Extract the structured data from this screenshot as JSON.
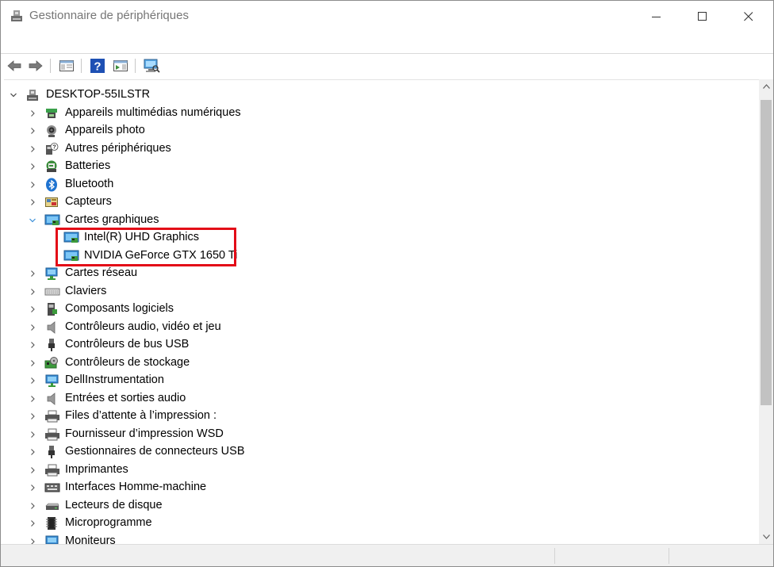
{
  "window": {
    "title": "Gestionnaire de périphériques",
    "icon": "device-manager-icon"
  },
  "toolbar": {
    "buttons": [
      {
        "name": "back-icon"
      },
      {
        "name": "forward-icon"
      },
      {
        "name": "show-hide-console-tree-icon"
      },
      {
        "name": "help-icon"
      },
      {
        "name": "properties-pane-icon"
      },
      {
        "name": "scan-hardware-icon"
      }
    ]
  },
  "tree": {
    "root": {
      "label": "DESKTOP-55ILSTR",
      "expanded": true,
      "icon": "computer-icon"
    },
    "categories": [
      {
        "label": "Appareils multimédias numériques",
        "icon": "multimedia-device-icon",
        "expanded": false
      },
      {
        "label": "Appareils photo",
        "icon": "camera-icon",
        "expanded": false
      },
      {
        "label": "Autres périphériques",
        "icon": "unknown-device-icon",
        "expanded": false
      },
      {
        "label": "Batteries",
        "icon": "battery-icon",
        "expanded": false
      },
      {
        "label": "Bluetooth",
        "icon": "bluetooth-icon",
        "expanded": false
      },
      {
        "label": "Capteurs",
        "icon": "sensor-icon",
        "expanded": false
      },
      {
        "label": "Cartes graphiques",
        "icon": "display-adapter-icon",
        "expanded": true,
        "children": [
          {
            "label": "Intel(R) UHD Graphics",
            "icon": "display-adapter-icon"
          },
          {
            "label": "NVIDIA GeForce GTX 1650 Ti",
            "icon": "display-adapter-icon"
          }
        ]
      },
      {
        "label": "Cartes réseau",
        "icon": "network-adapter-icon",
        "expanded": false
      },
      {
        "label": "Claviers",
        "icon": "keyboard-icon",
        "expanded": false
      },
      {
        "label": "Composants logiciels",
        "icon": "software-component-icon",
        "expanded": false
      },
      {
        "label": "Contrôleurs audio, vidéo et jeu",
        "icon": "speaker-icon",
        "expanded": false
      },
      {
        "label": "Contrôleurs de bus USB",
        "icon": "usb-icon",
        "expanded": false
      },
      {
        "label": "Contrôleurs de stockage",
        "icon": "storage-controller-icon",
        "expanded": false
      },
      {
        "label": "DellInstrumentation",
        "icon": "monitor-icon",
        "expanded": false
      },
      {
        "label": "Entrées et sorties audio",
        "icon": "speaker-icon",
        "expanded": false
      },
      {
        "label": "Files d’attente à l’impression :",
        "icon": "printer-icon",
        "expanded": false
      },
      {
        "label": "Fournisseur d’impression WSD",
        "icon": "printer-icon",
        "expanded": false
      },
      {
        "label": "Gestionnaires de connecteurs USB",
        "icon": "usb-icon",
        "expanded": false
      },
      {
        "label": "Imprimantes",
        "icon": "printer-icon",
        "expanded": false
      },
      {
        "label": "Interfaces Homme-machine",
        "icon": "hid-icon",
        "expanded": false
      },
      {
        "label": "Lecteurs de disque",
        "icon": "disk-drive-icon",
        "expanded": false
      },
      {
        "label": "Microprogramme",
        "icon": "firmware-icon",
        "expanded": false
      },
      {
        "label": "Moniteurs",
        "icon": "monitor-icon",
        "expanded": false
      }
    ]
  },
  "colors": {
    "highlight": "#e30b17",
    "title_text": "#767676"
  }
}
